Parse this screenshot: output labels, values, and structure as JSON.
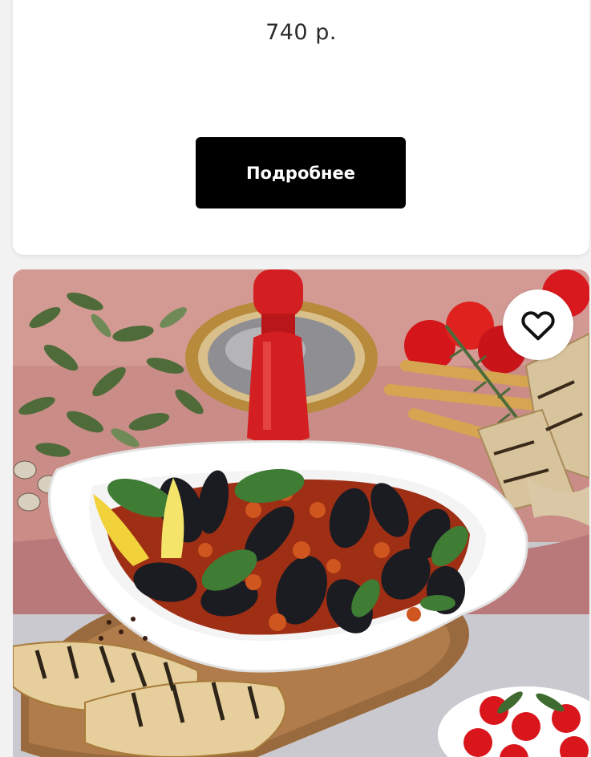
{
  "product_prev": {
    "price": "740 р.",
    "details_label": "Подробнее"
  },
  "product_next": {
    "image_alt": "Мидии в томатном соусе",
    "favorite_icon": "heart-outline-icon"
  },
  "colors": {
    "button_bg": "#000000",
    "button_text": "#ffffff",
    "card_bg": "#ffffff",
    "page_bg": "#f2f2f2"
  }
}
